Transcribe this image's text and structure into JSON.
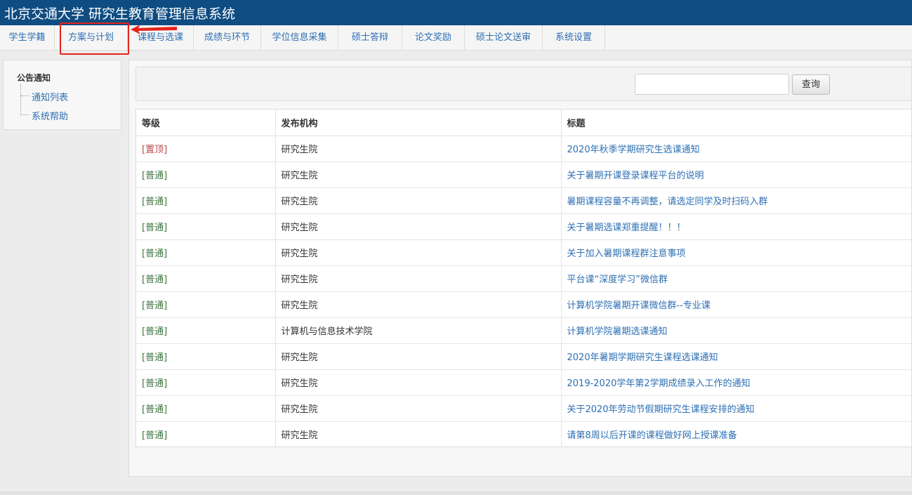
{
  "app": {
    "title": "北京交通大学 研究生教育管理信息系统"
  },
  "nav": {
    "tabs": [
      {
        "label": "学生学籍"
      },
      {
        "label": "方案与计划"
      },
      {
        "label": "课程与选课"
      },
      {
        "label": "成绩与环节"
      },
      {
        "label": "学位信息采集"
      },
      {
        "label": "硕士答辩"
      },
      {
        "label": "论文奖励"
      },
      {
        "label": "硕士论文送审"
      },
      {
        "label": "系统设置"
      }
    ]
  },
  "sidebar": {
    "header": "公告通知",
    "items": [
      {
        "label": "通知列表"
      },
      {
        "label": "系统帮助"
      }
    ]
  },
  "search": {
    "value": "",
    "button_label": "查询"
  },
  "table": {
    "headers": [
      "等级",
      "发布机构",
      "标题"
    ],
    "rows": [
      {
        "level": "[置顶]",
        "org": "研究生院",
        "title": "2020年秋季学期研究生选课通知"
      },
      {
        "level": "[普通]",
        "org": "研究生院",
        "title": "关于暑期开课登录课程平台的说明"
      },
      {
        "level": "[普通]",
        "org": "研究生院",
        "title": "暑期课程容量不再调整，请选定同学及时扫码入群"
      },
      {
        "level": "[普通]",
        "org": "研究生院",
        "title": "关于暑期选课郑重提醒！！！"
      },
      {
        "level": "[普通]",
        "org": "研究生院",
        "title": "关于加入暑期课程群注意事项"
      },
      {
        "level": "[普通]",
        "org": "研究生院",
        "title": "平台课“深度学习”微信群"
      },
      {
        "level": "[普通]",
        "org": "研究生院",
        "title": "计算机学院暑期开课微信群--专业课"
      },
      {
        "level": "[普通]",
        "org": "计算机与信息技术学院",
        "title": "计算机学院暑期选课通知"
      },
      {
        "level": "[普通]",
        "org": "研究生院",
        "title": "2020年暑期学期研究生课程选课通知"
      },
      {
        "level": "[普通]",
        "org": "研究生院",
        "title": "2019-2020学年第2学期成绩录入工作的通知"
      },
      {
        "level": "[普通]",
        "org": "研究生院",
        "title": "关于2020年劳动节假期研究生课程安排的通知"
      },
      {
        "level": "[普通]",
        "org": "研究生院",
        "title": "请第8周以后开课的课程做好网上授课准备"
      }
    ]
  },
  "colors": {
    "header_bg": "#0f4c81",
    "link": "#2d6fb3",
    "top_level": "#b94a48",
    "normal_level": "#3c763d",
    "highlight": "#e3241b"
  }
}
